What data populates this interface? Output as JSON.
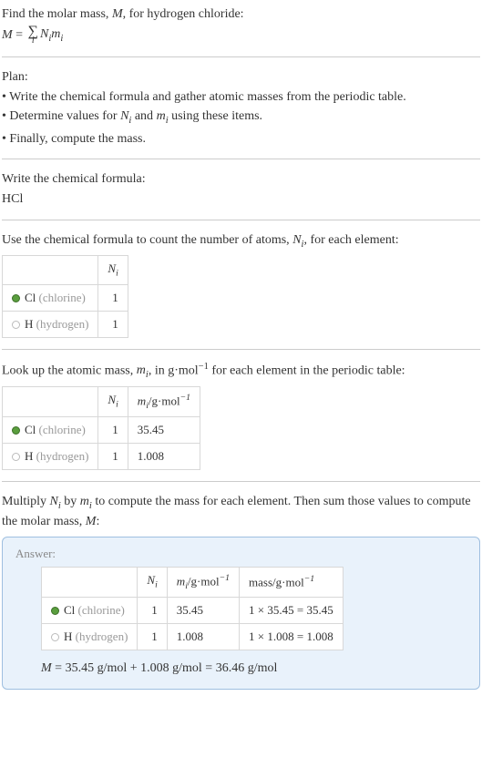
{
  "intro": {
    "line1_prefix": "Find the molar mass, ",
    "line1_var": "M",
    "line1_suffix": ", for hydrogen chloride:",
    "eq_left": "M",
    "eq_sum_under": "i",
    "eq_right1": "N",
    "eq_right1_sub": "i",
    "eq_right2": "m",
    "eq_right2_sub": "i"
  },
  "plan": {
    "heading": "Plan:",
    "b1": "• Write the chemical formula and gather atomic masses from the periodic table.",
    "b2_prefix": "• Determine values for ",
    "b2_n": "N",
    "b2_nsub": "i",
    "b2_and": " and ",
    "b2_m": "m",
    "b2_msub": "i",
    "b2_suffix": " using these items.",
    "b3": "• Finally, compute the mass."
  },
  "formula": {
    "heading": "Write the chemical formula:",
    "value": "HCl"
  },
  "count": {
    "heading_prefix": "Use the chemical formula to count the number of atoms, ",
    "heading_var": "N",
    "heading_sub": "i",
    "heading_suffix": ", for each element:",
    "col_n": "N",
    "col_n_sub": "i",
    "rows": [
      {
        "dot": "green",
        "sym": "Cl",
        "name": "(chlorine)",
        "n": "1"
      },
      {
        "dot": "white",
        "sym": "H",
        "name": "(hydrogen)",
        "n": "1"
      }
    ]
  },
  "mass": {
    "heading_prefix": "Look up the atomic mass, ",
    "heading_var": "m",
    "heading_sub": "i",
    "heading_mid": ", in g·mol",
    "heading_sup": "−1",
    "heading_suffix": " for each element in the periodic table:",
    "col_m": "m",
    "col_m_sub": "i",
    "col_m_unit": "/g·mol",
    "col_m_sup": "−1",
    "rows": [
      {
        "dot": "green",
        "sym": "Cl",
        "name": "(chlorine)",
        "n": "1",
        "m": "35.45"
      },
      {
        "dot": "white",
        "sym": "H",
        "name": "(hydrogen)",
        "n": "1",
        "m": "1.008"
      }
    ]
  },
  "compute": {
    "heading_p1": "Multiply ",
    "heading_n": "N",
    "heading_n_sub": "i",
    "heading_p2": " by ",
    "heading_m": "m",
    "heading_m_sub": "i",
    "heading_p3": " to compute the mass for each element. Then sum those values to compute the molar mass, ",
    "heading_M": "M",
    "heading_p4": ":"
  },
  "answer": {
    "label": "Answer:",
    "col_mass": "mass/g·mol",
    "col_mass_sup": "−1",
    "rows": [
      {
        "dot": "green",
        "sym": "Cl",
        "name": "(chlorine)",
        "n": "1",
        "m": "35.45",
        "calc": "1 × 35.45 = 35.45"
      },
      {
        "dot": "white",
        "sym": "H",
        "name": "(hydrogen)",
        "n": "1",
        "m": "1.008",
        "calc": "1 × 1.008 = 1.008"
      }
    ],
    "result_M": "M",
    "result_eq": " = 35.45 g/mol + 1.008 g/mol = 36.46 g/mol"
  }
}
